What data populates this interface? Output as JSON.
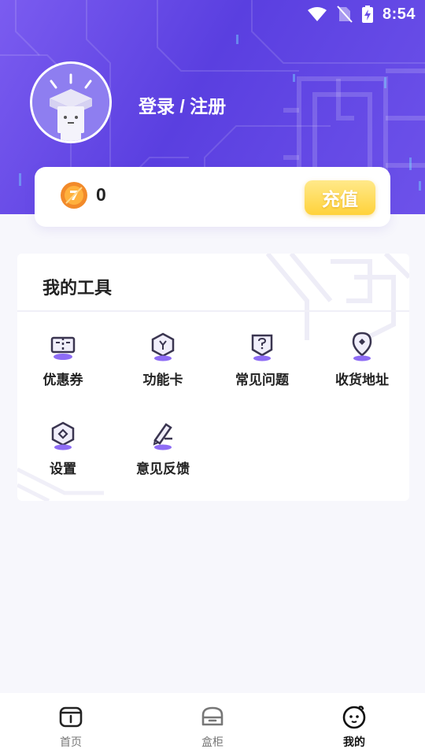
{
  "status_bar": {
    "time": "8:54"
  },
  "profile": {
    "login_label": "登录 / 注册"
  },
  "wallet": {
    "coins": "0",
    "recharge_label": "充值"
  },
  "tools": {
    "title": "我的工具",
    "items": [
      {
        "label": "优惠券",
        "icon": "coupon-icon"
      },
      {
        "label": "功能卡",
        "icon": "function-card-icon"
      },
      {
        "label": "常见问题",
        "icon": "faq-icon"
      },
      {
        "label": "收货地址",
        "icon": "address-icon"
      },
      {
        "label": "设置",
        "icon": "settings-icon"
      },
      {
        "label": "意见反馈",
        "icon": "feedback-icon"
      }
    ]
  },
  "bottom_nav": {
    "items": [
      {
        "label": "首页",
        "icon": "home-box-icon"
      },
      {
        "label": "盒柜",
        "icon": "cabinet-icon"
      },
      {
        "label": "我的",
        "icon": "profile-face-icon",
        "active": true
      }
    ]
  },
  "colors": {
    "hero_start": "#7b5cf0",
    "hero_end": "#5a3fe0",
    "accent_purple": "#7a5cf0",
    "recharge_gold": "#ffd23a"
  }
}
